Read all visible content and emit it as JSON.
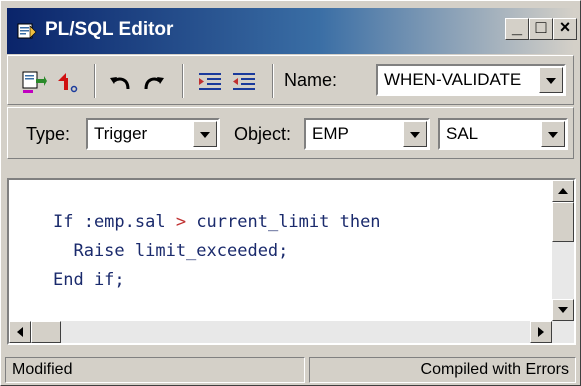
{
  "window": {
    "title": "PL/SQL Editor",
    "controls": {
      "minimize": "_",
      "maximize": "□",
      "close": "×"
    }
  },
  "toolbar": {
    "buttons": [
      "compile-icon",
      "revert-icon",
      "undo-icon",
      "redo-icon",
      "indent-icon",
      "outdent-icon"
    ],
    "name_label": "Name:",
    "name_value": "WHEN-VALIDATE"
  },
  "selectors": {
    "type_label": "Type:",
    "type_value": "Trigger",
    "object_label": "Object:",
    "object_value": "EMP",
    "item_value": "SAL"
  },
  "editor": {
    "lines": [
      {
        "before": "If :emp.sal ",
        "op": ">",
        "after": " current_limit then"
      },
      {
        "before": "  Raise limit_exceeded;",
        "op": "",
        "after": ""
      },
      {
        "before": "End if;",
        "op": "",
        "after": ""
      }
    ]
  },
  "status": {
    "left": "Modified",
    "right": "Compiled with Errors"
  },
  "colors": {
    "title_gradient_start": "#0a246a",
    "code_text": "#1a2a6c",
    "operator": "#c03030"
  }
}
